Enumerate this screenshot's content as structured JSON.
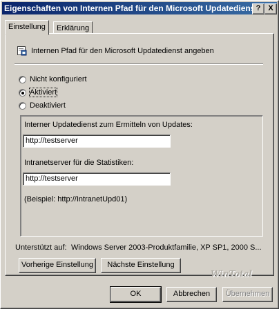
{
  "window": {
    "title": "Eigenschaften von Internen Pfad für den Microsoft Updatedienst..."
  },
  "titlebar_buttons": {
    "help": "?",
    "close": "X"
  },
  "tabs": [
    {
      "label": "Einstellung"
    },
    {
      "label": "Erklärung"
    }
  ],
  "policy": {
    "name": "Internen Pfad für den Microsoft Updatedienst angeben"
  },
  "options": [
    {
      "label": "Nicht konfiguriert",
      "checked": false
    },
    {
      "label": "Aktiviert",
      "checked": true
    },
    {
      "label": "Deaktiviert",
      "checked": false
    }
  ],
  "settings": {
    "update_service_label": "Interner Updatedienst zum Ermitteln von Updates:",
    "update_service_value": "http://testserver",
    "stats_server_label": "Intranetserver für die Statistiken:",
    "stats_server_value": "http://testserver",
    "example_text": "(Beispiel: http://IntranetUpd01)"
  },
  "supported_on": {
    "label": "Unterstützt auf:",
    "value": "Windows Server 2003-Produktfamilie, XP SP1, 2000 S..."
  },
  "nav_buttons": {
    "previous": "Vorherige Einstellung",
    "next": "Nächste Einstellung"
  },
  "watermark": "WinTotal",
  "dialog_buttons": {
    "ok": "OK",
    "cancel": "Abbrechen",
    "apply": "Übernehmen"
  }
}
